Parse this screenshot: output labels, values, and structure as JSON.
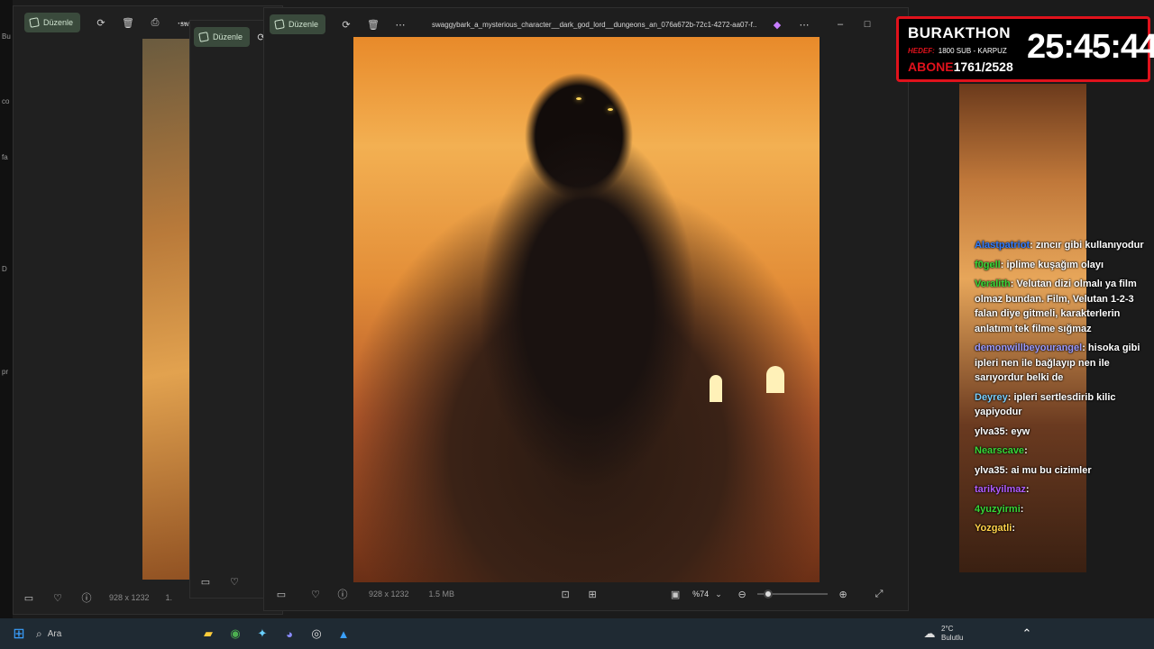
{
  "windows": {
    "back1": {
      "edit_label": "Düzenle",
      "info_dims": "928 x 1232",
      "info_extra": "1."
    },
    "back2": {
      "edit_label": "Düzenle",
      "title_fragment": "sw"
    },
    "main": {
      "edit_label": "Düzenle",
      "title": "swaggybark_a_mysterious_character__dark_god_lord__dungeons_an_076a672b-72c1-4272-aa07-f...",
      "info_dims": "928 x 1232",
      "info_size": "1.5 MB",
      "zoom": "%74",
      "zoom_level": 0.1
    }
  },
  "desk_strip_labels": [
    "Bu",
    "co",
    "fa",
    "D",
    "pr"
  ],
  "timer": {
    "title": "BURAKTHON",
    "goal_label": "HEDEF:",
    "goal_text": "1800 SUB - KARPUZ",
    "subs_label": "ABONE",
    "subs_value": "1761/2528",
    "clock": "25:45:44",
    "accent": "#e0121c"
  },
  "chat": [
    {
      "user": "Alastpatriot",
      "text": "zıncır gibi kullanıyodur",
      "color": "#2f7bff"
    },
    {
      "user": "f0gell",
      "text": "iplime kuşağım olayı",
      "color": "#38d838"
    },
    {
      "user": "Veralith",
      "text": "Velutan dizi olmalı ya film olmaz bundan. Film, Velutan 1-2-3 falan diye gitmeli, karakterlerin anlatımı tek filme sığmaz",
      "color": "#38d838"
    },
    {
      "user": "demonwillbeyourangel",
      "text": "hisoka gibi ipleri nen ile bağlayıp nen ile sarıyordur belki de",
      "color": "#9a9aff"
    },
    {
      "user": "Deyrey",
      "text": "ipleri sertlesdirib kilic yapiyodur",
      "color": "#7ad0ff"
    },
    {
      "user": "ylva35",
      "text": "eyw",
      "color": "#ffffff"
    },
    {
      "user": "Nearscave",
      "text": "",
      "color": "#38d838"
    },
    {
      "user": "ylva35",
      "text": "ai mu bu cizimler",
      "color": "#ffffff"
    },
    {
      "user": "tarikyilmaz",
      "text": "",
      "color": "#b05cff"
    },
    {
      "user": "4yuzyirmi",
      "text": "",
      "color": "#38d838"
    },
    {
      "user": "Yozgatli",
      "text": "",
      "color": "#ffd24a"
    }
  ],
  "taskbar": {
    "search_placeholder": "Ara",
    "weather_temp": "2°C",
    "weather_text": "Bulutlu"
  }
}
